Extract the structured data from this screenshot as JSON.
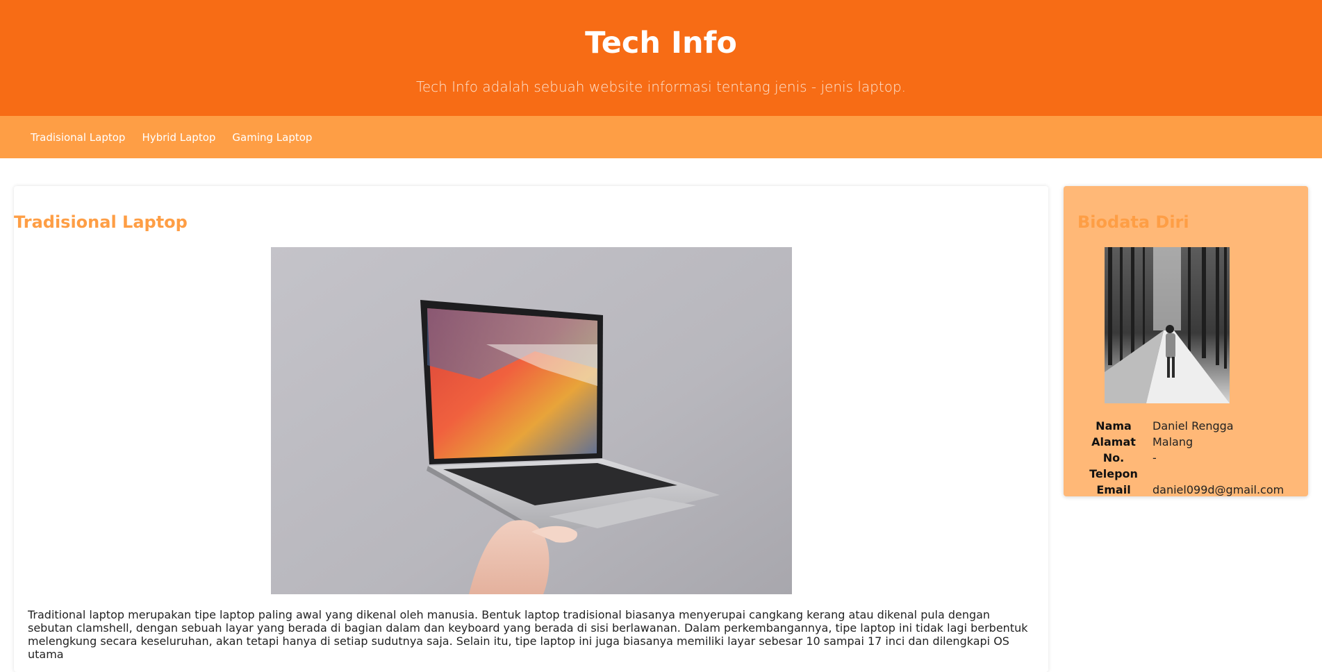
{
  "header": {
    "title": "Tech Info",
    "tagline": "Tech Info adalah sebuah website informasi tentang jenis - jenis laptop."
  },
  "nav": {
    "items": [
      {
        "label": "Tradisional Laptop"
      },
      {
        "label": "Hybrid Laptop"
      },
      {
        "label": "Gaming Laptop"
      }
    ]
  },
  "main": {
    "title": "Tradisional Laptop",
    "image": "laptop-photo",
    "paragraph": "Traditional laptop merupakan tipe laptop paling awal yang dikenal oleh manusia. Bentuk laptop tradisional biasanya menyerupai cangkang kerang atau dikenal pula dengan sebutan clamshell, dengan sebuah layar yang berada di bagian dalam dan keyboard yang berada di sisi berlawanan. Dalam perkembangannya, tipe laptop ini tidak lagi berbentuk melengkung secara keseluruhan, akan tetapi hanya di setiap sudutnya saja. Selain itu, tipe laptop ini juga biasanya memiliki layar sebesar 10 sampai 17 inci dan dilengkapi OS utama"
  },
  "sidebar": {
    "title": "Biodata Diri",
    "photo": "profile-photo",
    "rows": [
      {
        "key": "Nama",
        "value": "Daniel Rengga"
      },
      {
        "key": "Alamat",
        "value": "Malang"
      },
      {
        "key": "No. Telepon",
        "value": "-"
      },
      {
        "key": "Email",
        "value": "daniel099d@gmail.com"
      }
    ]
  },
  "colors": {
    "header": "#f76c15",
    "nav": "#fe9e45",
    "accent": "#fe9e45",
    "sidebar": "#ffb877"
  }
}
